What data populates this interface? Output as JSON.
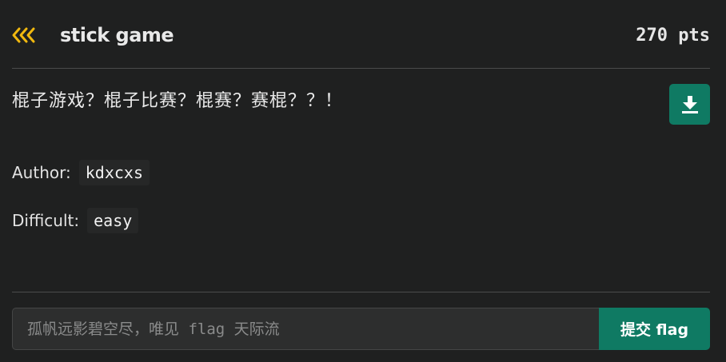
{
  "header": {
    "back_icon": "triple-chevron-left-icon",
    "accent_color": "#f0b80f",
    "title": "stick game",
    "points": "270 pts"
  },
  "challenge": {
    "description": "棍子游戏？棍子比赛？棍赛？赛棍？？！",
    "download_icon": "download-icon",
    "author_label": "Author:",
    "author": "kdxcxs",
    "difficulty_label": "Difficult:",
    "difficulty": "easy"
  },
  "flag_form": {
    "placeholder": "孤帆远影碧空尽，唯见 flag 天际流",
    "value": "",
    "submit_label": "提交 flag",
    "button_color": "#0f7a63"
  }
}
